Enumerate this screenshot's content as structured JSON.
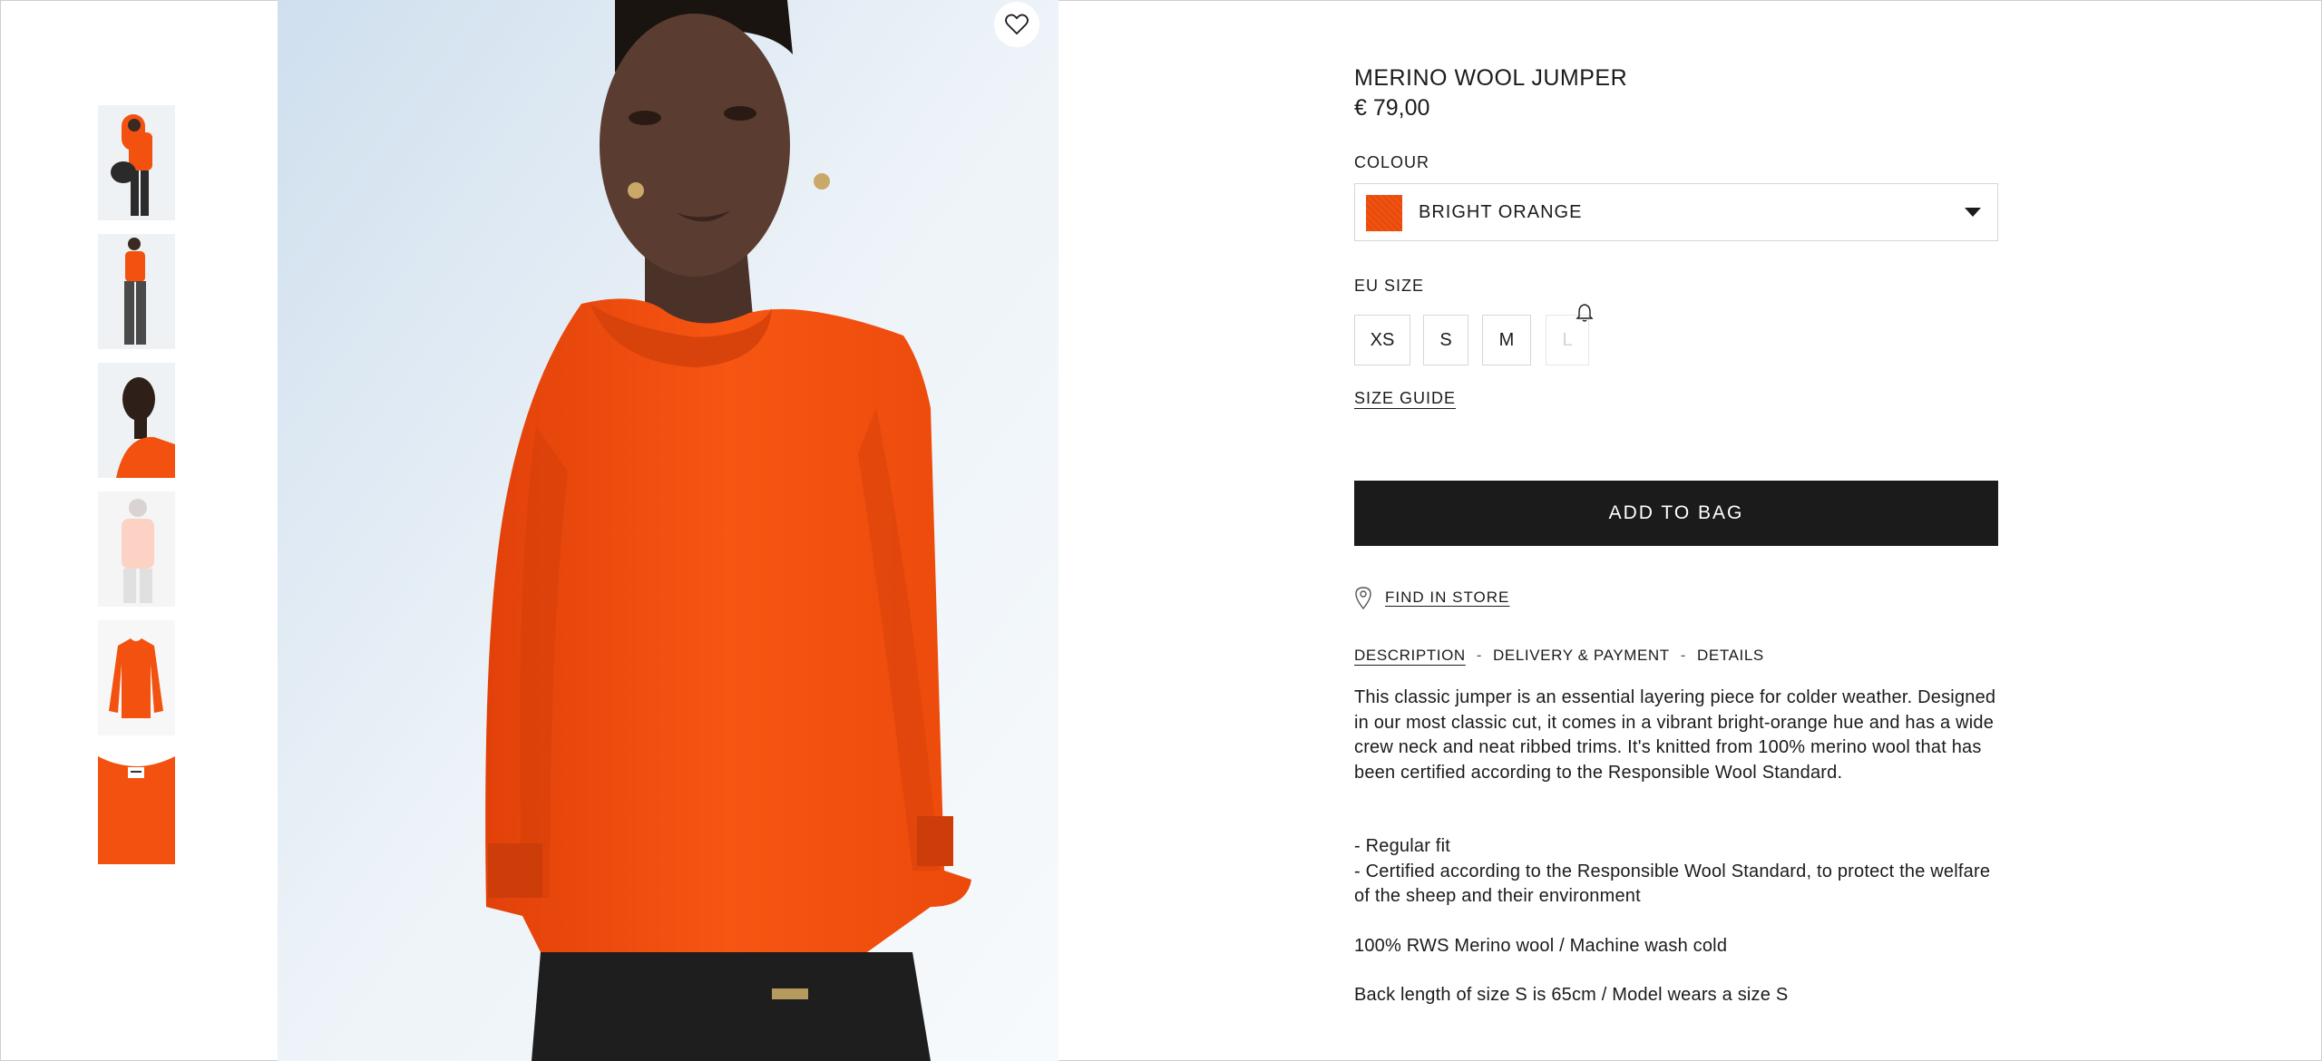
{
  "product": {
    "title": "MERINO WOOL JUMPER",
    "price": "€ 79,00",
    "accent_color": "#f2510f"
  },
  "thumbnails": [
    {
      "label": "",
      "icon": "model-side-hoodie"
    },
    {
      "label": "",
      "icon": "model-full-length"
    },
    {
      "label": "",
      "icon": "model-profile"
    },
    {
      "label": "",
      "icon": "model-faded"
    },
    {
      "label": "",
      "icon": "jumper-flat"
    },
    {
      "label": "",
      "icon": "jumper-collar-detail"
    }
  ],
  "main_image": {
    "icon": "model-wearing-orange-jumper"
  },
  "favourite": {
    "icon": "heart-icon"
  },
  "colour": {
    "label": "COLOUR",
    "selected": "BRIGHT ORANGE",
    "swatch_color": "#f2510f"
  },
  "size": {
    "label": "EU SIZE",
    "options": [
      {
        "label": "XS",
        "available": true
      },
      {
        "label": "S",
        "available": true
      },
      {
        "label": "M",
        "available": true
      },
      {
        "label": "L",
        "available": false
      }
    ],
    "notify_icon": "bell-icon"
  },
  "size_guide": "SIZE GUIDE",
  "add_to_bag": "ADD TO BAG",
  "find_in_store": {
    "label": "FIND IN STORE",
    "icon": "location-pin-icon"
  },
  "tabs": [
    {
      "label": "DESCRIPTION",
      "active": true
    },
    {
      "label": "DELIVERY & PAYMENT",
      "active": false
    },
    {
      "label": "DETAILS",
      "active": false
    }
  ],
  "description": {
    "intro": "This classic jumper is an essential layering piece for colder weather. Designed in our most classic cut, it comes in a vibrant bright-orange hue and has a wide crew neck and neat ribbed trims. It's knitted from 100% merino wool that has been certified according to the Responsible Wool Standard.",
    "bullets": [
      "- Regular fit",
      "- Certified according to the Responsible Wool Standard, to protect the welfare of the sheep and their environment"
    ],
    "composition": "100% RWS Merino wool / Machine wash cold",
    "fit_note": "Back length of size S is 65cm / Model wears a size S"
  }
}
